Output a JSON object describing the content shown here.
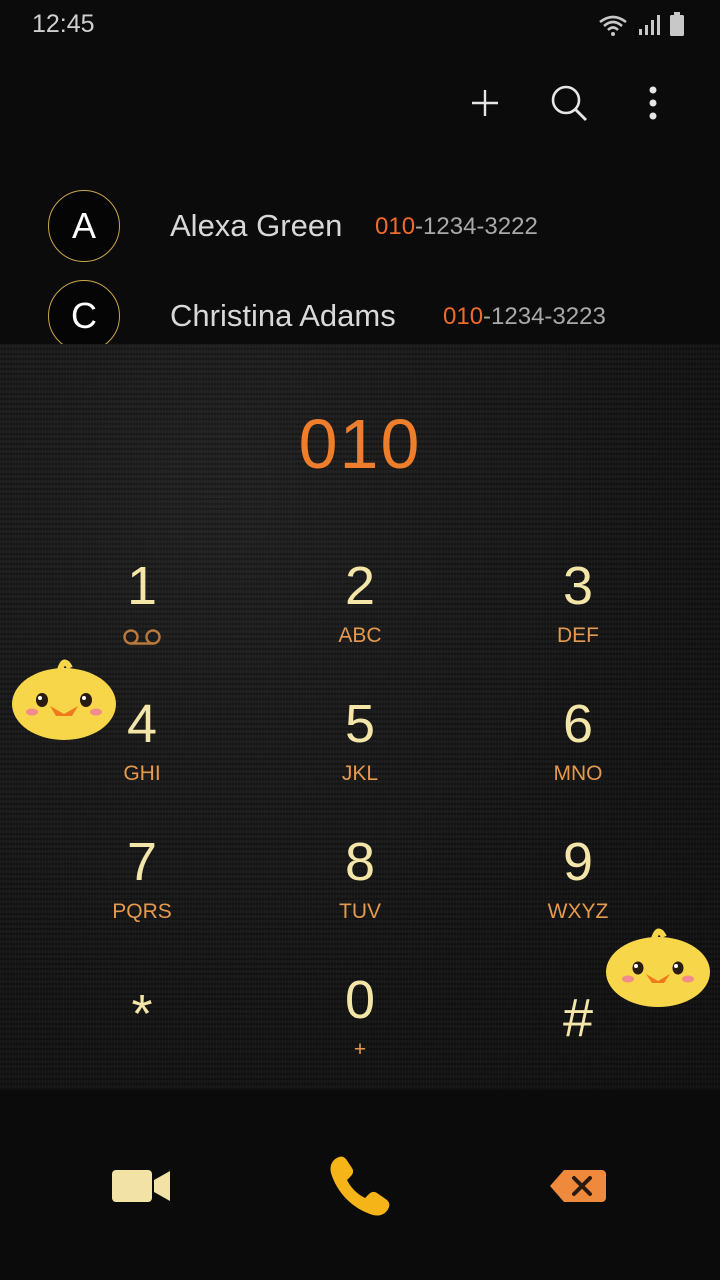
{
  "status_bar": {
    "time": "12:45"
  },
  "top_actions": [
    "add-icon",
    "search-icon",
    "more-options-icon"
  ],
  "contacts": [
    {
      "initial": "A",
      "name": "Alexa Green",
      "number_match": "010",
      "number_rest": "-1234-3222"
    },
    {
      "initial": "C",
      "name": "Christina Adams",
      "number_match": "010",
      "number_rest": "-1234-3223"
    }
  ],
  "dialer": {
    "entered_number": "010",
    "keys": [
      {
        "digit": "1",
        "letters": ""
      },
      {
        "digit": "2",
        "letters": "ABC"
      },
      {
        "digit": "3",
        "letters": "DEF"
      },
      {
        "digit": "4",
        "letters": "GHI"
      },
      {
        "digit": "5",
        "letters": "JKL"
      },
      {
        "digit": "6",
        "letters": "MNO"
      },
      {
        "digit": "7",
        "letters": "PQRS"
      },
      {
        "digit": "8",
        "letters": "TUV"
      },
      {
        "digit": "9",
        "letters": "WXYZ"
      },
      {
        "digit": "*",
        "letters": ""
      },
      {
        "digit": "0",
        "letters": "+"
      },
      {
        "digit": "#",
        "letters": ""
      }
    ]
  },
  "bottom_bar": [
    "video-call-icon",
    "phone-call-icon",
    "backspace-icon"
  ],
  "colors": {
    "accent": "#ee7d2c",
    "key_digit": "#f3e6a8",
    "key_letters": "#e4994f",
    "call_button": "#f5b418"
  }
}
